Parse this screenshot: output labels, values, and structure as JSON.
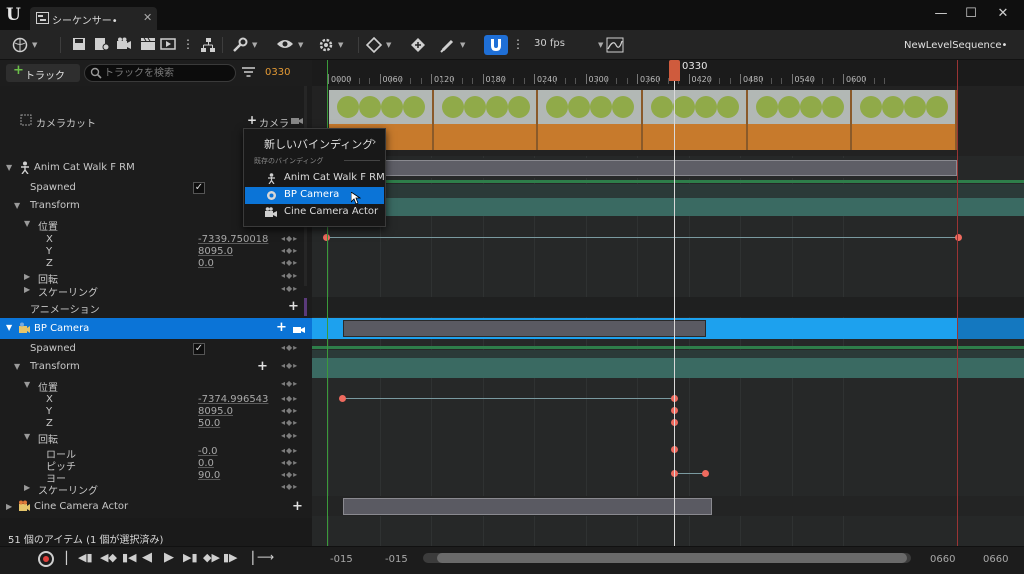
{
  "window": {
    "tab_title": "シーケンサー•",
    "sequence_name": "NewLevelSequence•",
    "controls": [
      "—",
      "☐",
      "✕"
    ]
  },
  "toolbar": {
    "fps": "30 fps",
    "snap_active": true,
    "accent": "#1f6fd6"
  },
  "outliner": {
    "add_track_label": "トラック",
    "search_placeholder": "トラックを検索",
    "current_frame": "0330",
    "status": "51 個のアイテム (1 個が選択済み)",
    "camera_cut": {
      "label": "カメラカット",
      "add_camera": "カメラ"
    },
    "rows": {
      "anim_cat": "Anim Cat Walk F RM",
      "spawned1": "Spawned",
      "transform1": "Transform",
      "location1": "位置",
      "x1_label": "X",
      "x1_value": "-7339.750018",
      "y1_label": "Y",
      "y1_value": "8095.0",
      "z1_label": "Z",
      "z1_value": "0.0",
      "rotation1": "回転",
      "scale1": "スケーリング",
      "animation1": "アニメーション",
      "bp_camera": "BP Camera",
      "spawned2": "Spawned",
      "transform2": "Transform",
      "location2": "位置",
      "x2_label": "X",
      "x2_value": "-7374.996543",
      "y2_label": "Y",
      "y2_value": "8095.0",
      "z2_label": "Z",
      "z2_value": "50.0",
      "rotation2": "回転",
      "roll_label": "ロール",
      "roll_value": "-0.0",
      "pitch_label": "ピッチ",
      "pitch_value": "0.0",
      "yaw_label": "ヨー",
      "yaw_value": "90.0",
      "scale2": "スケーリング",
      "cine_camera": "Cine Camera Actor"
    }
  },
  "timeline": {
    "playhead_label": "0330",
    "ruler_labels": [
      "0000",
      "0060",
      "0120",
      "0180",
      "0240",
      "0300",
      "0360",
      "0420",
      "0480",
      "0540",
      "0600"
    ],
    "range_start_outer": "-015",
    "range_start_inner": "-015",
    "range_end_inner": "0660",
    "range_end_outer": "0660"
  },
  "context_menu": {
    "new_binding": "新しいバインディング",
    "existing_section": "既存のバインディング",
    "items": [
      "Anim Cat Walk F RM",
      "BP Camera",
      "Cine Camera Actor"
    ],
    "highlighted_index": 1
  }
}
